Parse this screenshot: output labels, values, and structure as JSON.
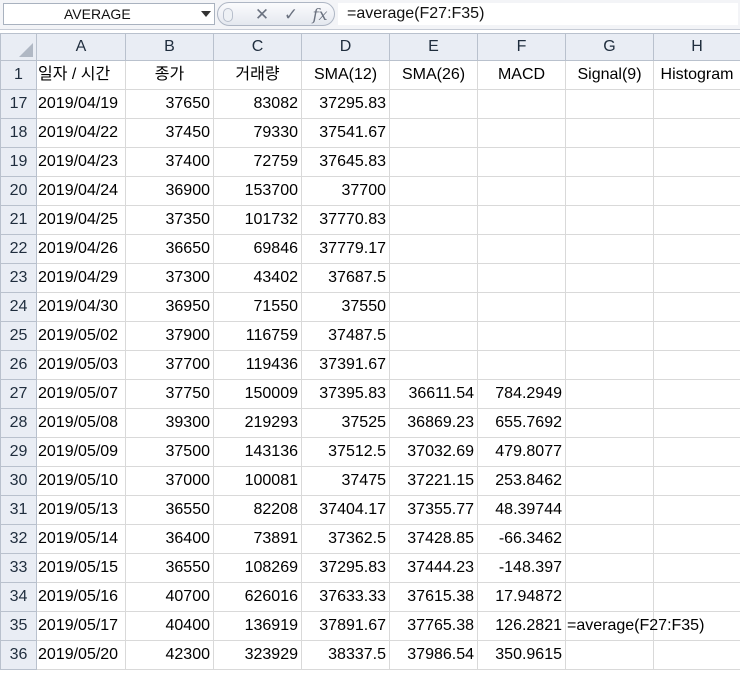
{
  "formula_bar": {
    "name_box": "AVERAGE",
    "formula": "=average(F27:F35)"
  },
  "columns": [
    "A",
    "B",
    "C",
    "D",
    "E",
    "F",
    "G",
    "H"
  ],
  "rows": [
    {
      "num": "1",
      "cells": [
        "일자 / 시간",
        "종가",
        "거래량",
        "SMA(12)",
        "SMA(26)",
        "MACD",
        "Signal(9)",
        "Histogram"
      ]
    },
    {
      "num": "17",
      "cells": [
        "2019/04/19",
        "37650",
        "83082",
        "37295.83",
        "",
        "",
        "",
        ""
      ]
    },
    {
      "num": "18",
      "cells": [
        "2019/04/22",
        "37450",
        "79330",
        "37541.67",
        "",
        "",
        "",
        ""
      ]
    },
    {
      "num": "19",
      "cells": [
        "2019/04/23",
        "37400",
        "72759",
        "37645.83",
        "",
        "",
        "",
        ""
      ]
    },
    {
      "num": "20",
      "cells": [
        "2019/04/24",
        "36900",
        "153700",
        "37700",
        "",
        "",
        "",
        ""
      ]
    },
    {
      "num": "21",
      "cells": [
        "2019/04/25",
        "37350",
        "101732",
        "37770.83",
        "",
        "",
        "",
        ""
      ]
    },
    {
      "num": "22",
      "cells": [
        "2019/04/26",
        "36650",
        "69846",
        "37779.17",
        "",
        "",
        "",
        ""
      ]
    },
    {
      "num": "23",
      "cells": [
        "2019/04/29",
        "37300",
        "43402",
        "37687.5",
        "",
        "",
        "",
        ""
      ]
    },
    {
      "num": "24",
      "cells": [
        "2019/04/30",
        "36950",
        "71550",
        "37550",
        "",
        "",
        "",
        ""
      ]
    },
    {
      "num": "25",
      "cells": [
        "2019/05/02",
        "37900",
        "116759",
        "37487.5",
        "",
        "",
        "",
        ""
      ]
    },
    {
      "num": "26",
      "cells": [
        "2019/05/03",
        "37700",
        "119436",
        "37391.67",
        "",
        "",
        "",
        ""
      ]
    },
    {
      "num": "27",
      "cells": [
        "2019/05/07",
        "37750",
        "150009",
        "37395.83",
        "36611.54",
        "784.2949",
        "",
        ""
      ]
    },
    {
      "num": "28",
      "cells": [
        "2019/05/08",
        "39300",
        "219293",
        "37525",
        "36869.23",
        "655.7692",
        "",
        ""
      ]
    },
    {
      "num": "29",
      "cells": [
        "2019/05/09",
        "37500",
        "143136",
        "37512.5",
        "37032.69",
        "479.8077",
        "",
        ""
      ]
    },
    {
      "num": "30",
      "cells": [
        "2019/05/10",
        "37000",
        "100081",
        "37475",
        "37221.15",
        "253.8462",
        "",
        ""
      ]
    },
    {
      "num": "31",
      "cells": [
        "2019/05/13",
        "36550",
        "82208",
        "37404.17",
        "37355.77",
        "48.39744",
        "",
        ""
      ]
    },
    {
      "num": "32",
      "cells": [
        "2019/05/14",
        "36400",
        "73891",
        "37362.5",
        "37428.85",
        "-66.3462",
        "",
        ""
      ]
    },
    {
      "num": "33",
      "cells": [
        "2019/05/15",
        "36550",
        "108269",
        "37295.83",
        "37444.23",
        "-148.397",
        "",
        ""
      ]
    },
    {
      "num": "34",
      "cells": [
        "2019/05/16",
        "40700",
        "626016",
        "37633.33",
        "37615.38",
        "17.94872",
        "",
        ""
      ]
    },
    {
      "num": "35",
      "cells": [
        "2019/05/17",
        "40400",
        "136919",
        "37891.67",
        "37765.38",
        "126.2821",
        "=average(F27:F35)",
        ""
      ]
    },
    {
      "num": "36",
      "cells": [
        "2019/05/20",
        "42300",
        "323929",
        "38337.5",
        "37986.54",
        "350.9615",
        "",
        ""
      ]
    }
  ]
}
